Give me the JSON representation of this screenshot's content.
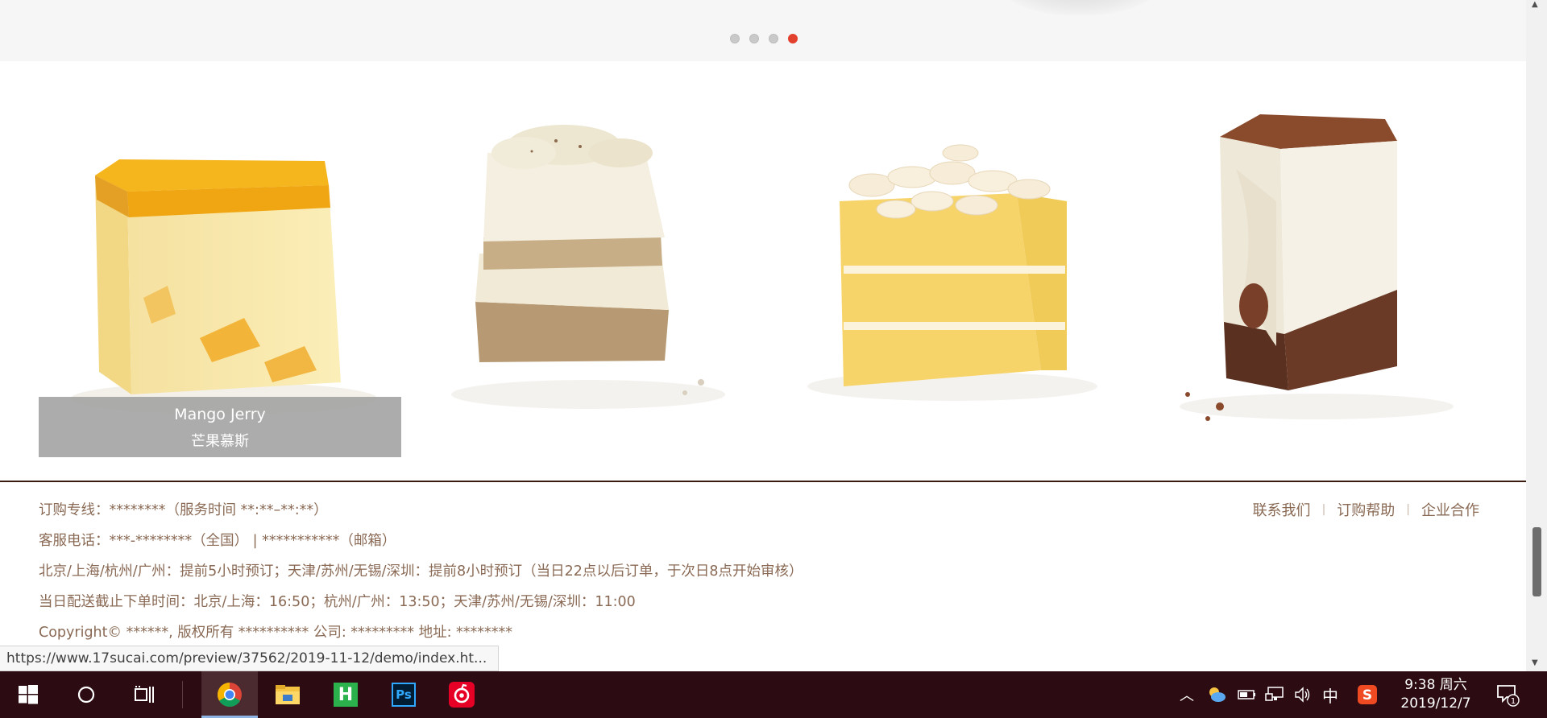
{
  "carousel": {
    "dots": [
      {
        "active": false
      },
      {
        "active": false
      },
      {
        "active": false
      },
      {
        "active": true
      }
    ]
  },
  "products": [
    {
      "name_en": "Mango Jerry",
      "name_cn": "芒果慕斯",
      "caption_visible": true
    },
    {
      "caption_visible": false
    },
    {
      "caption_visible": false
    },
    {
      "caption_visible": false
    }
  ],
  "footer": {
    "info_lines": [
      "订购专线：********（服务时间 **:**–**:**）",
      "客服电话：***-********（全国） | ***********（邮箱）",
      "北京/上海/杭州/广州：提前5小时预订；天津/苏州/无锡/深圳：提前8小时预订（当日22点以后订单，于次日8点开始审核）",
      "当日配送截止下单时间：北京/上海：16:50；杭州/广州：13:50；天津/苏州/无锡/深圳：11:00",
      "Copyright© ******, 版权所有 ********** 公司: ********* 地址: ********"
    ],
    "links": [
      "联系我们",
      "订购帮助",
      "企业合作"
    ]
  },
  "status_url": "https://www.17sucai.com/preview/37562/2019-11-12/demo/index.ht...",
  "taskbar": {
    "apps": [
      "start-icon",
      "search-circle-icon",
      "task-view-icon",
      "chrome-icon",
      "file-explorer-icon",
      "hbuilder-icon",
      "photoshop-icon",
      "netease-music-icon"
    ],
    "hbuilder_letter": "H",
    "photoshop_letters": "Ps",
    "tray_ime": "中",
    "clock_time": "9:38 周六",
    "clock_date": "2019/12/7",
    "notification_count": "1"
  },
  "colors": {
    "accent_dot": "#e2412e",
    "footer_text": "#8a6a55",
    "footer_rule": "#3a1c10",
    "taskbar": "#2c0c12"
  }
}
